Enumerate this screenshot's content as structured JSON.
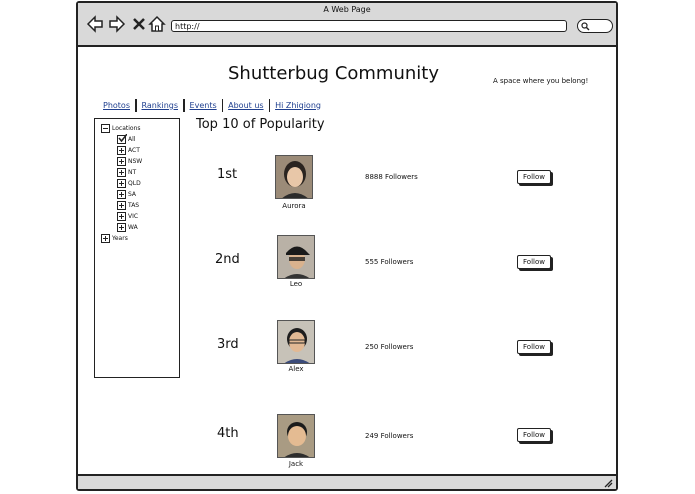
{
  "window": {
    "title": "A Web Page",
    "url": "http://"
  },
  "site": {
    "title": "Shutterbug Community",
    "tagline": "A space where you belong!"
  },
  "nav": {
    "tabs": [
      "Photos",
      "Rankings",
      "Events",
      "About us",
      "Hi Zhiqiong"
    ]
  },
  "tree": {
    "root": "Locations",
    "children": [
      "All",
      "ACT",
      "NSW",
      "NT",
      "QLD",
      "SA",
      "TAS",
      "VIC",
      "WA"
    ],
    "checked": "All",
    "second_root": "Years"
  },
  "ranking": {
    "heading": "Top 10 of Popularity",
    "entries": [
      {
        "rank": "1st",
        "name": "Aurora",
        "followers": "8888 Followers",
        "button": "Follow"
      },
      {
        "rank": "2nd",
        "name": "Leo",
        "followers": "555 Followers",
        "button": "Follow"
      },
      {
        "rank": "3rd",
        "name": "Alex",
        "followers": "250 Followers",
        "button": "Follow"
      },
      {
        "rank": "4th",
        "name": "Jack",
        "followers": "249 Followers",
        "button": "Follow"
      }
    ]
  }
}
